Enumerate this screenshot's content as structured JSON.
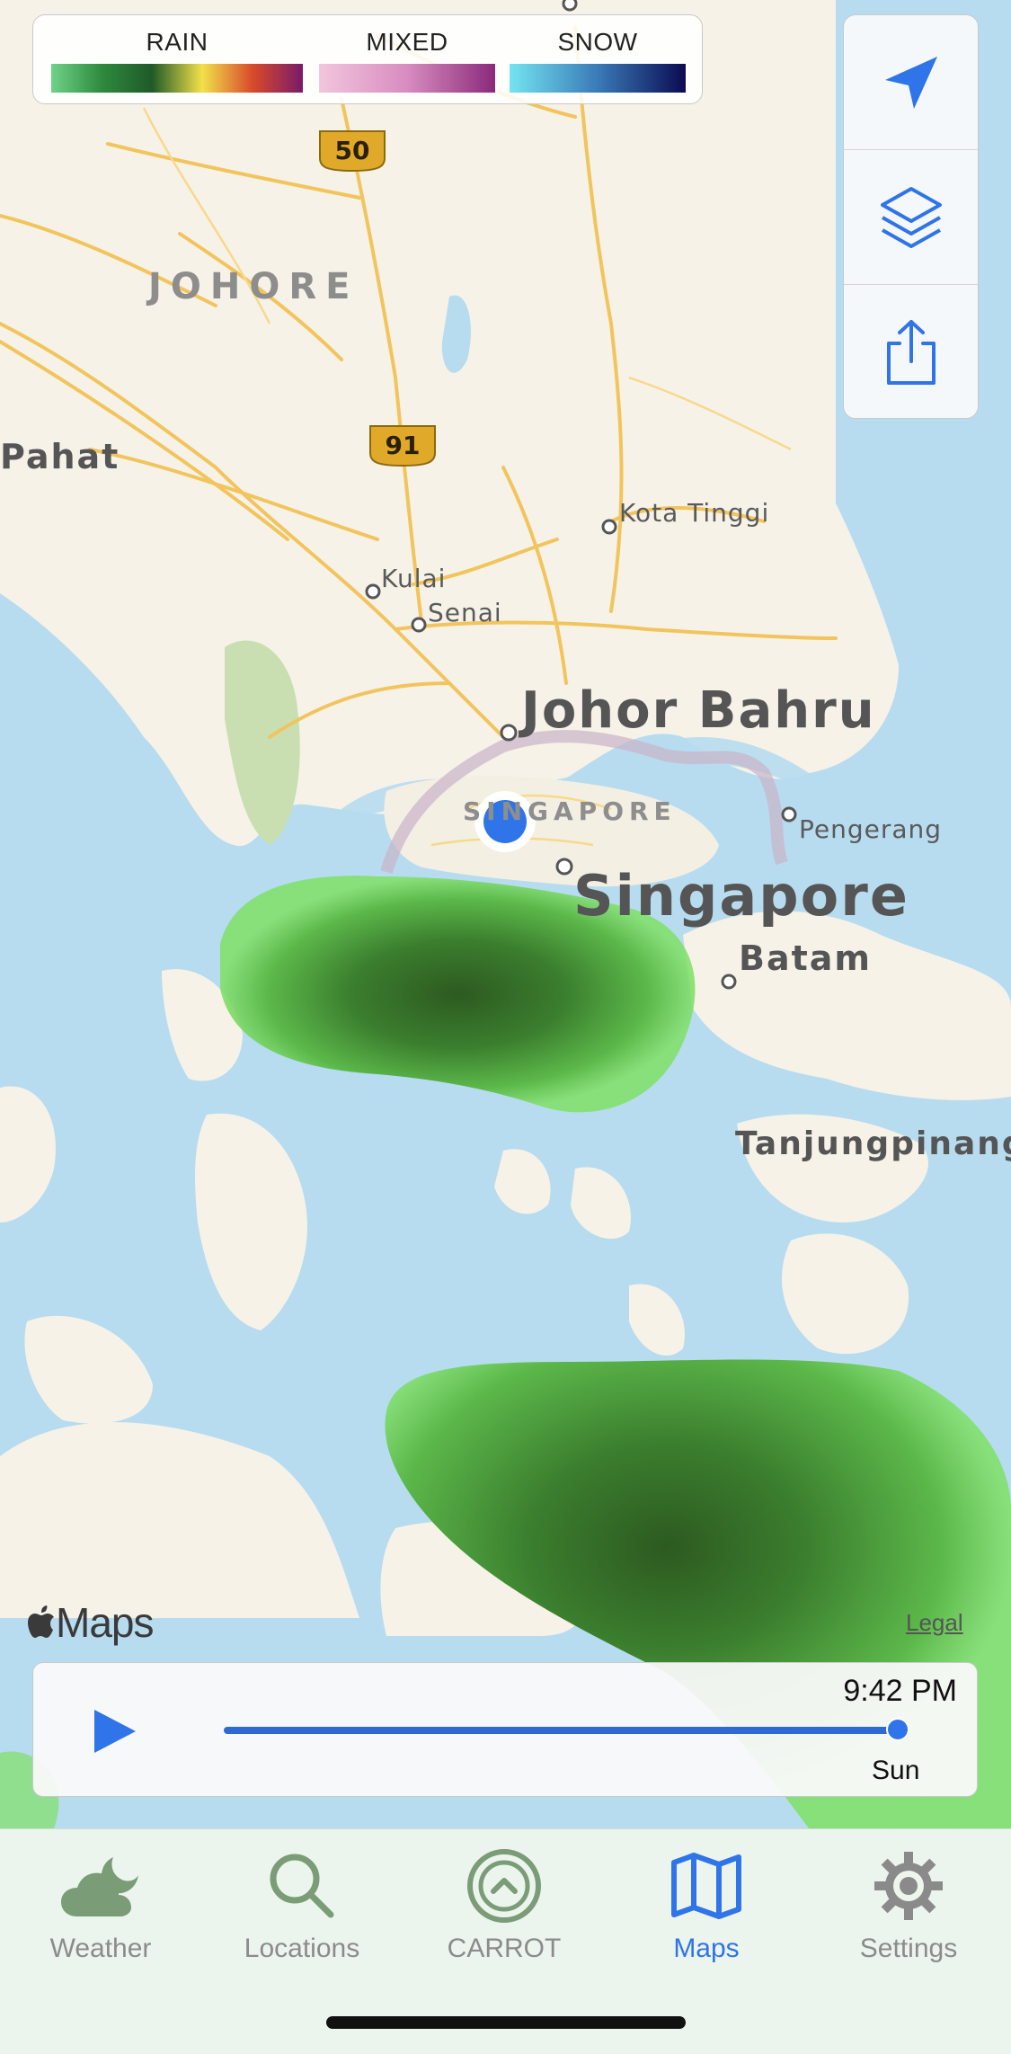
{
  "legend": {
    "items": [
      {
        "label": "RAIN",
        "gradient": [
          "#6fd38a",
          "#2e8a3e",
          "#1f5a28",
          "#f2e14a",
          "#d84a2a",
          "#7a1a6a"
        ]
      },
      {
        "label": "MIXED",
        "gradient": [
          "#f2c6dd",
          "#d88cc0",
          "#8a2a7a"
        ]
      },
      {
        "label": "SNOW",
        "gradient": [
          "#74e4f0",
          "#3a7ab8",
          "#0b0b52"
        ]
      }
    ]
  },
  "controls": [
    {
      "name": "locate",
      "icon": "location-arrow-icon"
    },
    {
      "name": "layers",
      "icon": "layers-icon"
    },
    {
      "name": "share",
      "icon": "share-icon"
    }
  ],
  "map": {
    "region_label": "JOHORE",
    "labels": {
      "pahat": "Pahat",
      "kota_tinggi": "Kota Tinggi",
      "kulai": "Kulai",
      "senai": "Senai",
      "johor_bahru": "Johor Bahru",
      "singapore_small": "SINGAPORE",
      "pengerang": "Pengerang",
      "singapore": "Singapore",
      "batam": "Batam",
      "tanjungpinang": "Tanjungpinang"
    },
    "route_shields": [
      "50",
      "91"
    ],
    "colors": {
      "land": "#f6f2e8",
      "water": "#b7dcef",
      "road": "#f2c45c",
      "rain": "#3f9a3a"
    }
  },
  "attribution": {
    "brand": "Maps",
    "legal": "Legal"
  },
  "playback": {
    "time": "9:42 PM",
    "day": "Sun",
    "progress": 1.0,
    "accent": "#2f74e8"
  },
  "tabs": [
    {
      "label": "Weather",
      "icon": "weather-icon",
      "active": false
    },
    {
      "label": "Locations",
      "icon": "search-icon",
      "active": false
    },
    {
      "label": "CARROT",
      "icon": "carrot-icon",
      "active": false
    },
    {
      "label": "Maps",
      "icon": "map-icon",
      "active": true
    },
    {
      "label": "Settings",
      "icon": "gear-icon",
      "active": false
    }
  ]
}
